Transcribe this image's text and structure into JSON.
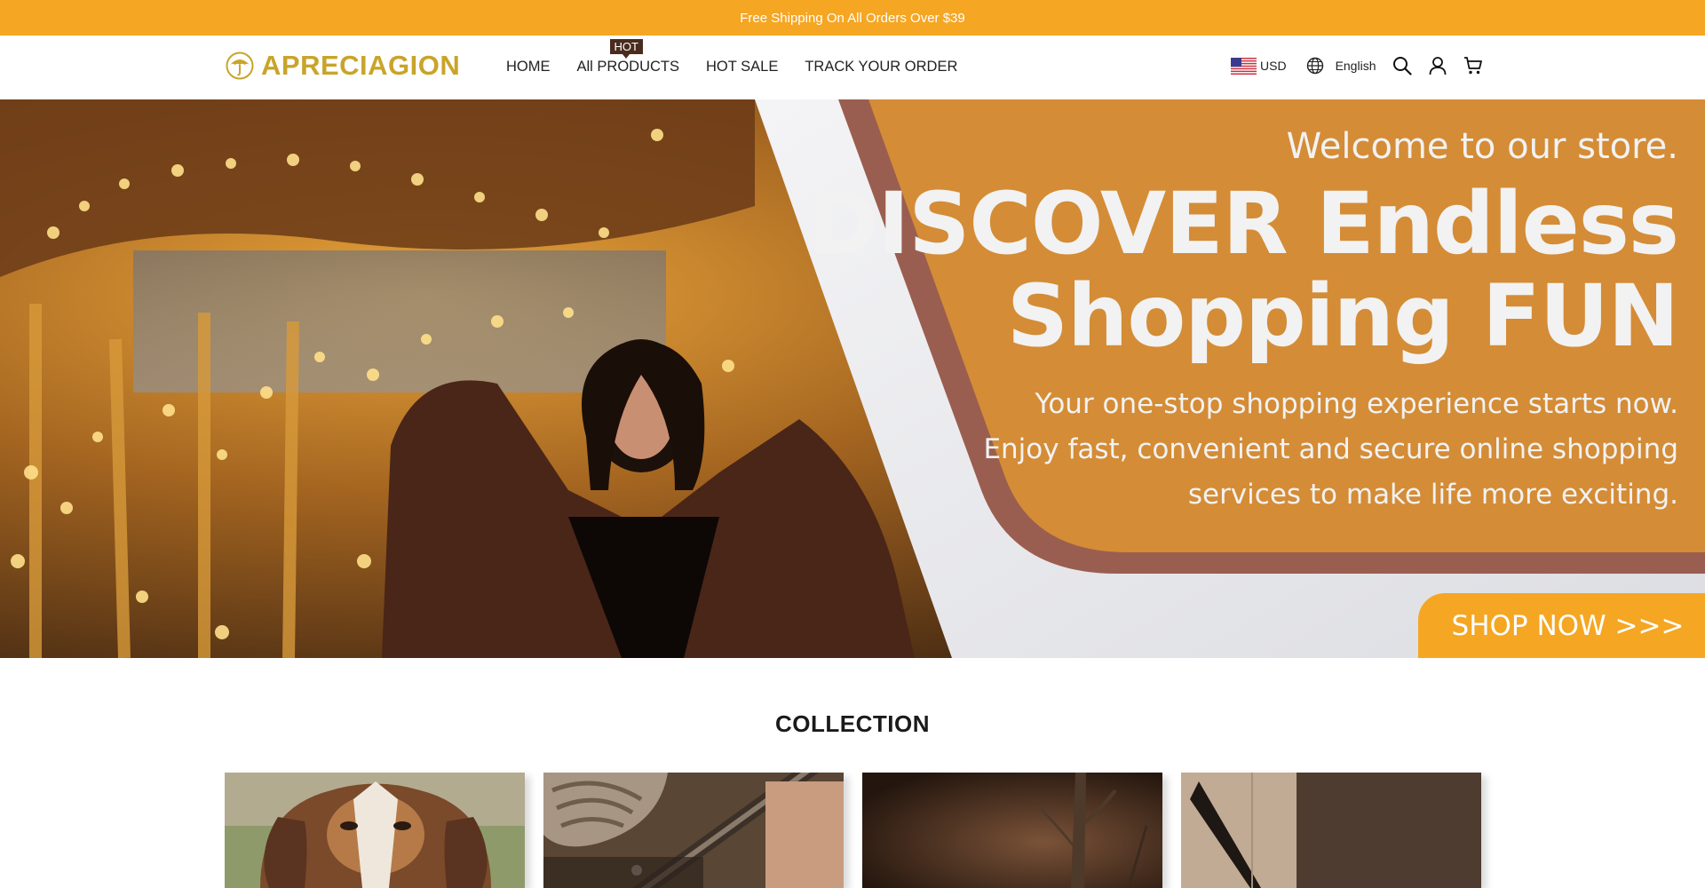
{
  "announcement": {
    "text": "Free Shipping On All Orders Over $39",
    "glyph": "",
    "background": "#f5a623"
  },
  "header": {
    "logo_text": "APRECIAGION",
    "logo_icon": "umbrella-icon",
    "brand_color": "#c9a42a",
    "nav": [
      {
        "label": "HOME"
      },
      {
        "label": "All PRODUCTS",
        "badge": "HOT"
      },
      {
        "label": "HOT SALE"
      },
      {
        "label": "TRACK YOUR ORDER"
      }
    ],
    "currency": {
      "label": "USD",
      "icon": "us-flag-icon"
    },
    "language": {
      "label": "English",
      "icon": "globe-icon"
    },
    "icons": [
      "search-icon",
      "account-icon",
      "cart-icon"
    ]
  },
  "hero": {
    "welcome": "Welcome to our store.",
    "headline_line1": "DISCOVER Endless",
    "headline_line2": "Shopping FUN",
    "sub_line1": "Your one-stop shopping experience starts now.",
    "sub_line2": "Enjoy fast, convenient and secure online shopping",
    "sub_line3": "services to make life more exciting.",
    "cta": "SHOP NOW >>>",
    "panel_color": "#d48c36",
    "border_color": "#9a5e50"
  },
  "collection": {
    "title": "COLLECTION",
    "cards": [
      {
        "name": "collection-card-dog"
      },
      {
        "name": "collection-card-tools"
      },
      {
        "name": "collection-card-decor"
      },
      {
        "name": "collection-card-furniture"
      }
    ]
  }
}
